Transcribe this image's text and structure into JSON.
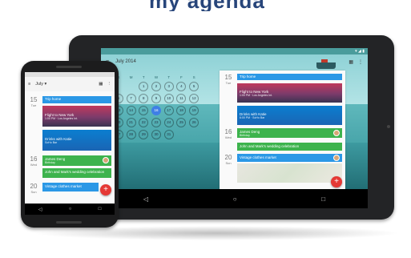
{
  "banner_fragment": "my agenda",
  "tablet": {
    "status_icons": "▾ ◢ ▮",
    "header": {
      "menu_icon": "menu-icon",
      "title": "July 2014",
      "calendar_icon": "calendar-icon",
      "overflow_icon": "overflow-icon"
    },
    "calendar": {
      "weekdays": [
        "S",
        "M",
        "T",
        "W",
        "T",
        "F",
        "S"
      ],
      "rows": [
        [
          "",
          "",
          "1",
          "2",
          "3",
          "4",
          "5"
        ],
        [
          "6",
          "7",
          "8",
          "9",
          "10",
          "11",
          "12"
        ],
        [
          "13",
          "14",
          "15",
          "16",
          "17",
          "18",
          "19"
        ],
        [
          "20",
          "21",
          "22",
          "23",
          "24",
          "25",
          "26"
        ],
        [
          "27",
          "28",
          "29",
          "30",
          "31",
          "",
          ""
        ]
      ],
      "selected": "16"
    },
    "agenda": [
      {
        "day_num": "15",
        "day_name": "Tue",
        "title": "Trip home"
      },
      {
        "title": "Flight to New York",
        "sub": "1:00 PM · Los Angeles Int."
      },
      {
        "title": "Drinks with Katie",
        "sub": "6:00 PM · SoHo Bar"
      },
      {
        "day_num": "16",
        "day_name": "Wed",
        "title": "James Deng",
        "sub": "Birthday"
      },
      {
        "title": "John and Mark's wedding celebration",
        "sub": ""
      },
      {
        "day_num": "20",
        "day_name": "Sun",
        "title": "Vintage clothes market",
        "sub": ""
      }
    ],
    "fab": "+",
    "nav": [
      "◁",
      "○",
      "□"
    ]
  },
  "phone": {
    "header": {
      "menu_icon": "menu-icon",
      "title": "July ▾",
      "calendar_icon": "calendar-icon",
      "overflow_icon": "overflow-icon"
    },
    "agenda": [
      {
        "day_num": "15",
        "day_name": "Tue",
        "title": "Trip home"
      },
      {
        "title": "Flight to New York",
        "sub": "1:00 PM · Los Angeles Int."
      },
      {
        "title": "Drinks with Katie",
        "sub": "SoHo Bar"
      },
      {
        "day_num": "16",
        "day_name": "Wed",
        "title": "James Deng",
        "sub": "Birthday"
      },
      {
        "title": "John and Mark's wedding celebration",
        "sub": ""
      },
      {
        "day_num": "20",
        "day_name": "Sun",
        "title": "Vintage clothes market",
        "sub": ""
      }
    ],
    "fab": "+",
    "nav": [
      "◁",
      "○",
      "□"
    ]
  },
  "colors": {
    "blue": "#2b98e6",
    "green": "#3db34d",
    "fab": "#e53935",
    "teal": "#4a9c9c"
  }
}
